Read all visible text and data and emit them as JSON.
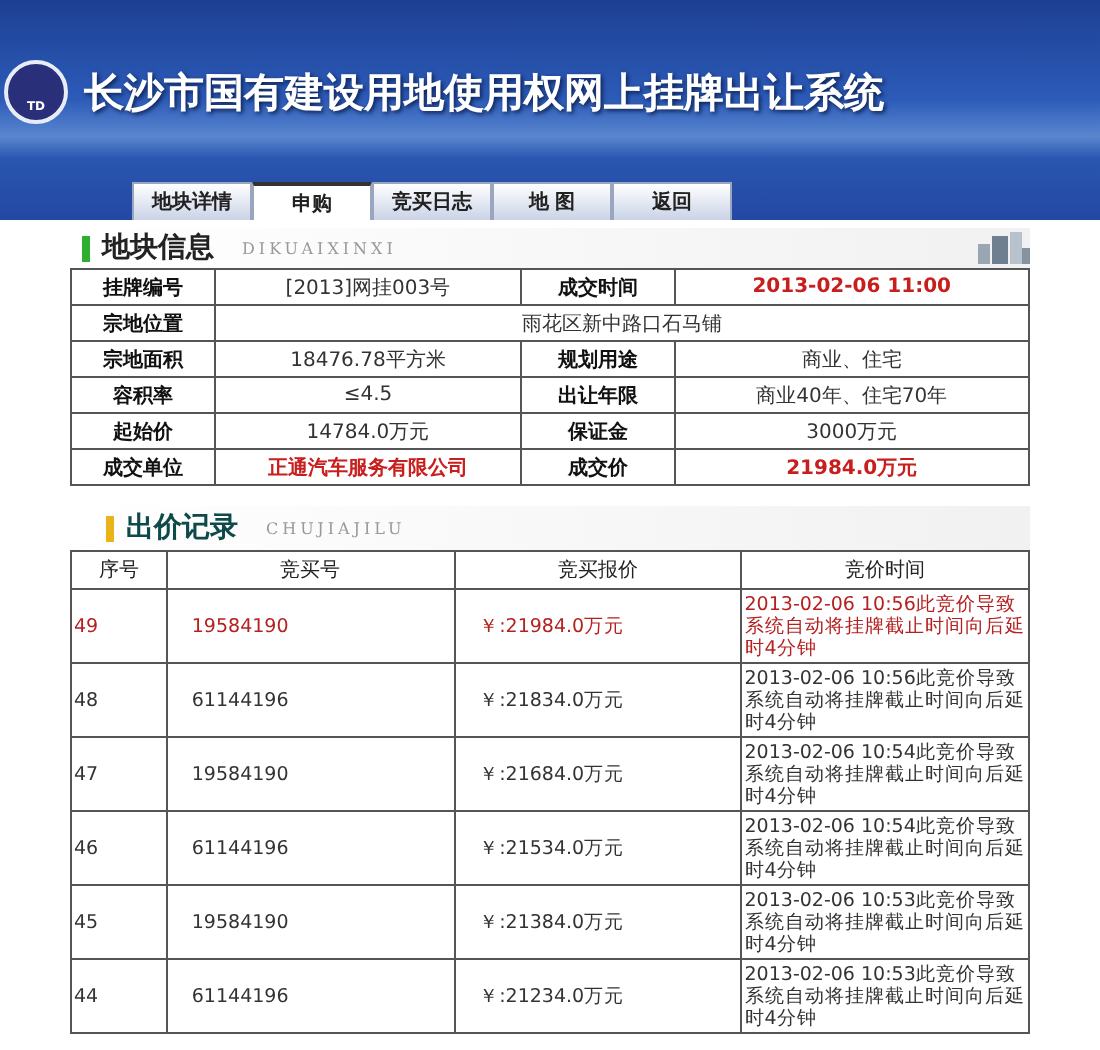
{
  "header": {
    "logo_text": "TD",
    "title": "长沙市国有建设用地使用权网上挂牌出让系统"
  },
  "tabs": [
    {
      "label": "地块详情",
      "selected": false
    },
    {
      "label": "申购",
      "selected": true
    },
    {
      "label": "竞买日志",
      "selected": false
    },
    {
      "label": "地 图",
      "selected": false
    },
    {
      "label": "返回",
      "selected": false
    }
  ],
  "land_info": {
    "title": "地块信息",
    "subtitle": "DIKUAIXINXI",
    "rows": [
      [
        {
          "label": "挂牌编号",
          "value": "[2013]网挂003号",
          "emphasis": false
        },
        {
          "label": "成交时间",
          "value": "2013-02-06 11:00",
          "emphasis": true
        }
      ],
      [
        {
          "label": "宗地位置",
          "value": "雨花区新中路口石马铺",
          "emphasis": false
        }
      ],
      [
        {
          "label": "宗地面积",
          "value": "18476.78平方米",
          "emphasis": false
        },
        {
          "label": "规划用途",
          "value": "商业、住宅",
          "emphasis": false
        }
      ],
      [
        {
          "label": "容积率",
          "value": "≤4.5",
          "emphasis": false
        },
        {
          "label": "出让年限",
          "value": "商业40年、住宅70年",
          "emphasis": false
        }
      ],
      [
        {
          "label": "起始价",
          "value": "14784.0万元",
          "emphasis": false
        },
        {
          "label": "保证金",
          "value": "3000万元",
          "emphasis": false
        }
      ],
      [
        {
          "label": "成交单位",
          "value": "正通汽车服务有限公司",
          "emphasis": true
        },
        {
          "label": "成交价",
          "value": "21984.0万元",
          "emphasis": true
        }
      ]
    ]
  },
  "bids": {
    "title": "出价记录",
    "subtitle": "CHUJIAJILU",
    "columns": [
      "序号",
      "竞买号",
      "竞买报价",
      "竞价时间"
    ],
    "rows": [
      {
        "no": "49",
        "bidder": "19584190",
        "price": "￥:21984.0万元",
        "time": "2013-02-06 10:56此竞价导致系统自动将挂牌截止时间向后延时4分钟",
        "highlighted": true
      },
      {
        "no": "48",
        "bidder": "61144196",
        "price": "￥:21834.0万元",
        "time": "2013-02-06 10:56此竞价导致系统自动将挂牌截止时间向后延时4分钟",
        "highlighted": false
      },
      {
        "no": "47",
        "bidder": "19584190",
        "price": "￥:21684.0万元",
        "time": "2013-02-06 10:54此竞价导致系统自动将挂牌截止时间向后延时4分钟",
        "highlighted": false
      },
      {
        "no": "46",
        "bidder": "61144196",
        "price": "￥:21534.0万元",
        "time": "2013-02-06 10:54此竞价导致系统自动将挂牌截止时间向后延时4分钟",
        "highlighted": false
      },
      {
        "no": "45",
        "bidder": "19584190",
        "price": "￥:21384.0万元",
        "time": "2013-02-06 10:53此竞价导致系统自动将挂牌截止时间向后延时4分钟",
        "highlighted": false
      },
      {
        "no": "44",
        "bidder": "61144196",
        "price": "￥:21234.0万元",
        "time": "2013-02-06 10:53此竞价导致系统自动将挂牌截止时间向后延时4分钟",
        "highlighted": false
      }
    ]
  }
}
